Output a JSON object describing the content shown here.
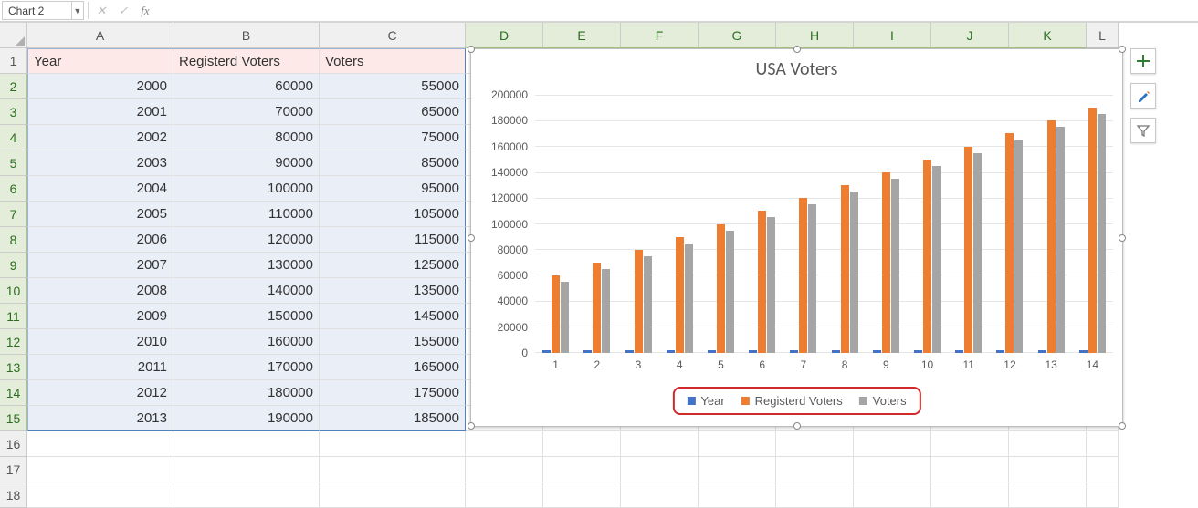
{
  "namebox": "Chart 2",
  "columns": [
    "A",
    "B",
    "C",
    "D",
    "E",
    "F",
    "G",
    "H",
    "I",
    "J",
    "K",
    "L"
  ],
  "rows": [
    "1",
    "2",
    "3",
    "4",
    "5",
    "6",
    "7",
    "8",
    "9",
    "10",
    "11",
    "12",
    "13",
    "14",
    "15",
    "16"
  ],
  "table": {
    "headers": [
      "Year",
      "Registerd Voters",
      "Voters"
    ],
    "rows": [
      [
        "2000",
        "60000",
        "55000"
      ],
      [
        "2001",
        "70000",
        "65000"
      ],
      [
        "2002",
        "80000",
        "75000"
      ],
      [
        "2003",
        "90000",
        "85000"
      ],
      [
        "2004",
        "100000",
        "95000"
      ],
      [
        "2005",
        "110000",
        "105000"
      ],
      [
        "2006",
        "120000",
        "115000"
      ],
      [
        "2007",
        "130000",
        "125000"
      ],
      [
        "2008",
        "140000",
        "135000"
      ],
      [
        "2009",
        "150000",
        "145000"
      ],
      [
        "2010",
        "160000",
        "155000"
      ],
      [
        "2011",
        "170000",
        "165000"
      ],
      [
        "2012",
        "180000",
        "175000"
      ],
      [
        "2013",
        "190000",
        "185000"
      ]
    ]
  },
  "chart_data": {
    "type": "bar",
    "title": "USA Voters",
    "ylabel": "",
    "ylim": [
      0,
      200000
    ],
    "yticks": [
      0,
      20000,
      40000,
      60000,
      80000,
      100000,
      120000,
      140000,
      160000,
      180000,
      200000
    ],
    "categories": [
      "1",
      "2",
      "3",
      "4",
      "5",
      "6",
      "7",
      "8",
      "9",
      "10",
      "11",
      "12",
      "13",
      "14"
    ],
    "series": [
      {
        "name": "Year",
        "color": "#4472c4",
        "values": [
          2000,
          2001,
          2002,
          2003,
          2004,
          2005,
          2006,
          2007,
          2008,
          2009,
          2010,
          2011,
          2012,
          2013
        ]
      },
      {
        "name": "Registerd Voters",
        "color": "#ed7d31",
        "values": [
          60000,
          70000,
          80000,
          90000,
          100000,
          110000,
          120000,
          130000,
          140000,
          150000,
          160000,
          170000,
          180000,
          190000
        ]
      },
      {
        "name": "Voters",
        "color": "#a5a5a5",
        "values": [
          55000,
          65000,
          75000,
          85000,
          95000,
          105000,
          115000,
          125000,
          135000,
          145000,
          155000,
          165000,
          175000,
          185000
        ]
      }
    ],
    "legend": [
      "Year",
      "Registerd Voters",
      "Voters"
    ]
  },
  "fx": {
    "cancel": "✕",
    "enter": "✓",
    "fx": "fx"
  }
}
